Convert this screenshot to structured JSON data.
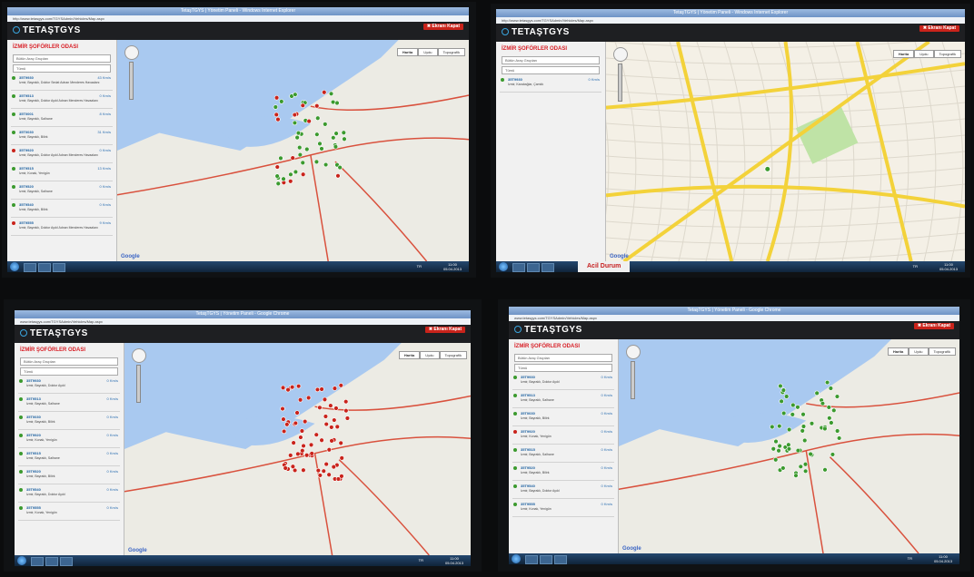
{
  "colors": {
    "accent_red": "#d81f26",
    "brand_blue": "#39a9e6",
    "marker_green": "#3b9a2e",
    "marker_red": "#c9231b",
    "road_yellow": "#f3d23a",
    "sea": "#a9c9f0",
    "land": "#ecebe4"
  },
  "common": {
    "brand": "TETAŞTGYS",
    "close_label": "Ekranı Kapat",
    "sidebar_title": "İZMİR ŞOFÖRLER ODASI",
    "map_types": [
      "Harita",
      "Uydu",
      "Topografik"
    ],
    "google": "Google",
    "lang": "TR",
    "clock_time": "11:00",
    "clock_date": "05.04.2013",
    "emergency": "Acil Durum"
  },
  "screens": [
    {
      "window_title": "TetaşTGYS | Yönetim Paneli - Windows Internet Explorer",
      "url": "http://www.tetasgys.com/TGYSAdmin/Vehicles/Map.aspx",
      "selects": [
        "Bütün Araç Grupları",
        "Tümü"
      ],
      "vehicles": [
        {
          "plate": "35T9930",
          "speed": "43 Km/s",
          "addr": "İzmir, Bayraklı, Doktor Sedat Adnan Menderes Havaalanı",
          "status": "green"
        },
        {
          "plate": "35T9513",
          "speed": "0 Km/s",
          "addr": "İzmir, Bayraklı, Doktor Aydıl Adnan Menderes Havaalanı",
          "status": "green"
        },
        {
          "plate": "35T0001",
          "speed": "8 Km/s",
          "addr": "İzmir, Bayraklı, Salhane",
          "status": "green"
        },
        {
          "plate": "35T0030",
          "speed": "31 Km/s",
          "addr": "İzmir, Bayraklı, Bilirk",
          "status": "green"
        },
        {
          "plate": "35T9920",
          "speed": "0 Km/s",
          "addr": "İzmir, Bayraklı, Doktor Aydıl Adnan Menderes Havaalanı",
          "status": "red"
        },
        {
          "plate": "35T9515",
          "speed": "13 Km/s",
          "addr": "İzmir, Konak, Yenigün",
          "status": "green"
        },
        {
          "plate": "35T9520",
          "speed": "0 Km/s",
          "addr": "İzmir, Bayraklı, Salhane",
          "status": "green"
        },
        {
          "plate": "35T9540",
          "speed": "0 Km/s",
          "addr": "İzmir, Bayraklı, Bilirk",
          "status": "green"
        },
        {
          "plate": "35T9555",
          "speed": "9 Km/s",
          "addr": "İzmir, Bayraklı, Doktor Aydıl Adnan Menderes Havaalanı",
          "status": "red"
        }
      ]
    },
    {
      "window_title": "TetaşTGYS | Yönetim Paneli - Windows Internet Explorer",
      "url": "http://www.tetasgys.com/TGYSAdmin/Vehicles/Map.aspx",
      "selects": [
        "Bütün Araç Grupları",
        "Tümü"
      ],
      "vehicles": [
        {
          "plate": "35T9930",
          "speed": "0 Km/s",
          "addr": "İzmir, Karabağlar, Çamlık",
          "status": "green"
        }
      ]
    },
    {
      "window_title": "TetaşTGYS | Yönetim Paneli - Google Chrome",
      "url": "www.tetasgys.com/TGYSAdmin/Vehicles/Map.aspx",
      "selects": [
        "Bütün Araç Grupları",
        "Tümü"
      ],
      "vehicles": [
        {
          "plate": "35T9930",
          "speed": "0 Km/s",
          "addr": "İzmir, Bayraklı, Doktor Aydıl",
          "status": "green"
        },
        {
          "plate": "35T9513",
          "speed": "0 Km/s",
          "addr": "İzmir, Bayraklı, Salhane",
          "status": "green"
        },
        {
          "plate": "35T0030",
          "speed": "0 Km/s",
          "addr": "İzmir, Bayraklı, Bilirk",
          "status": "green"
        },
        {
          "plate": "35T9920",
          "speed": "0 Km/s",
          "addr": "İzmir, Konak, Yenigün",
          "status": "green"
        },
        {
          "plate": "35T9515",
          "speed": "0 Km/s",
          "addr": "İzmir, Bayraklı, Salhane",
          "status": "green"
        },
        {
          "plate": "35T9520",
          "speed": "0 Km/s",
          "addr": "İzmir, Bayraklı, Bilirk",
          "status": "green"
        },
        {
          "plate": "35T9540",
          "speed": "0 Km/s",
          "addr": "İzmir, Bayraklı, Doktor Aydıl",
          "status": "green"
        },
        {
          "plate": "35T9555",
          "speed": "0 Km/s",
          "addr": "İzmir, Konak, Yenigün",
          "status": "green"
        }
      ]
    },
    {
      "window_title": "TetaşTGYS | Yönetim Paneli - Google Chrome",
      "url": "www.tetasgys.com/TGYSAdmin/Vehicles/Map.aspx",
      "selects": [
        "Bütün Araç Grupları",
        "Tümü"
      ],
      "vehicles": [
        {
          "plate": "35T9930",
          "speed": "0 Km/s",
          "addr": "İzmir, Bayraklı, Doktor Aydıl",
          "status": "green"
        },
        {
          "plate": "35T9513",
          "speed": "0 Km/s",
          "addr": "İzmir, Bayraklı, Salhane",
          "status": "green"
        },
        {
          "plate": "35T0030",
          "speed": "0 Km/s",
          "addr": "İzmir, Bayraklı, Bilirk",
          "status": "green"
        },
        {
          "plate": "35T9920",
          "speed": "0 Km/s",
          "addr": "İzmir, Konak, Yenigün",
          "status": "red"
        },
        {
          "plate": "35T9515",
          "speed": "0 Km/s",
          "addr": "İzmir, Bayraklı, Salhane",
          "status": "green"
        },
        {
          "plate": "35T9520",
          "speed": "0 Km/s",
          "addr": "İzmir, Bayraklı, Bilirk",
          "status": "green"
        },
        {
          "plate": "35T9540",
          "speed": "0 Km/s",
          "addr": "İzmir, Bayraklı, Doktor Aydıl",
          "status": "green"
        },
        {
          "plate": "35T9555",
          "speed": "0 Km/s",
          "addr": "İzmir, Konak, Yenigün",
          "status": "green"
        }
      ]
    }
  ]
}
